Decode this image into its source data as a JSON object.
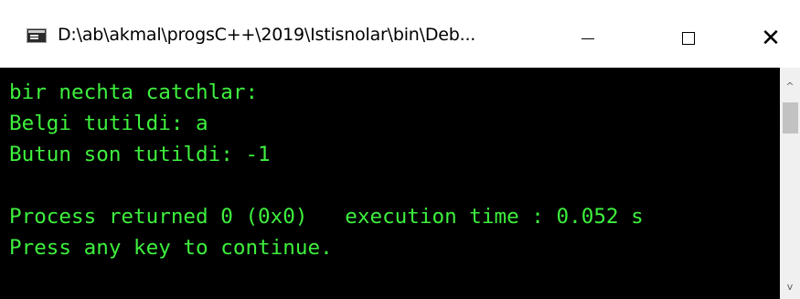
{
  "window": {
    "title": "D:\\ab\\akmal\\progsC++\\2019\\Istisnolar\\bin\\Deb...",
    "controls": {
      "minimize": "",
      "maximize": "",
      "close": "✕"
    }
  },
  "console": {
    "lines": [
      "bir nechta catchlar:",
      "Belgi tutildi: a",
      "Butun son tutildi: -1",
      "",
      "Process returned 0 (0x0)   execution time : 0.052 s",
      "Press any key to continue."
    ],
    "text_color": "#3ef03e",
    "background_color": "#000000"
  },
  "scrollbar": {
    "up_arrow": "^",
    "down_arrow": "v"
  }
}
